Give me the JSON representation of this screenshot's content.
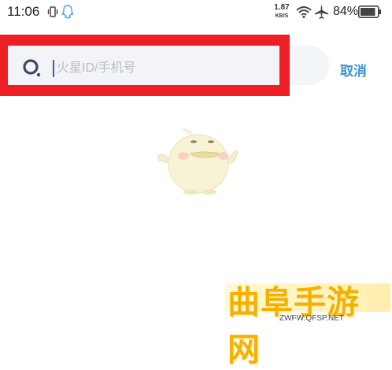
{
  "status_bar": {
    "time": "11:06",
    "net_speed_value": "1.87",
    "net_speed_unit": "KB/S",
    "battery_percent": "84%",
    "icons": [
      "vibrate-icon",
      "qq-icon",
      "wifi-icon",
      "airplane-icon",
      "battery-icon"
    ]
  },
  "search": {
    "placeholder": "火星ID/手机号",
    "value": "",
    "cancel_label": "取消",
    "highlight_color": "#ee1f24"
  },
  "empty_state": {
    "illustration": "chick-mascot"
  },
  "watermark": {
    "title": "曲阜手游网",
    "url": "ZWFW.QFSP.NET"
  },
  "colors": {
    "accent": "#3f92d9",
    "caret": "#2a63b8"
  }
}
